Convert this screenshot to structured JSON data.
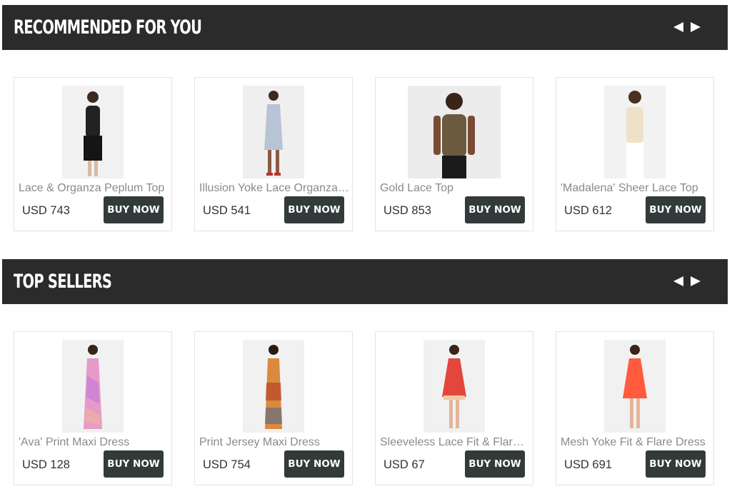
{
  "sections": [
    {
      "title": "RECOMMENDED FOR YOU",
      "products": [
        {
          "name": "Lace & Organza Peplum Top",
          "price": "USD 743",
          "buy_label": "BUY NOW",
          "image": "woman-black-peplum-top"
        },
        {
          "name": "Illusion Yoke Lace Organza Dress",
          "price": "USD 541",
          "buy_label": "BUY NOW",
          "image": "woman-light-blue-lace-dress"
        },
        {
          "name": "Gold Lace Top",
          "price": "USD 853",
          "buy_label": "BUY NOW",
          "image": "woman-gold-lace-top"
        },
        {
          "name": "'Madalena' Sheer Lace Top",
          "price": "USD 612",
          "buy_label": "BUY NOW",
          "image": "woman-cream-lace-top"
        }
      ]
    },
    {
      "title": "TOP SELLERS",
      "products": [
        {
          "name": "'Ava' Print Maxi Dress",
          "price": "USD 128",
          "buy_label": "BUY NOW",
          "image": "woman-pink-print-maxi-dress"
        },
        {
          "name": "Print Jersey Maxi Dress",
          "price": "USD 754",
          "buy_label": "BUY NOW",
          "image": "woman-orange-print-maxi-dress"
        },
        {
          "name": "Sleeveless Lace Fit & Flare Dress",
          "price": "USD 67",
          "buy_label": "BUY NOW",
          "image": "woman-red-lace-dress"
        },
        {
          "name": "Mesh Yoke Fit & Flare Dress",
          "price": "USD 691",
          "buy_label": "BUY NOW",
          "image": "woman-coral-dress"
        }
      ]
    }
  ],
  "colors": {
    "header_bg": "#2b2b2b",
    "button_bg": "#323a3a",
    "card_border": "#e3e3e3"
  }
}
